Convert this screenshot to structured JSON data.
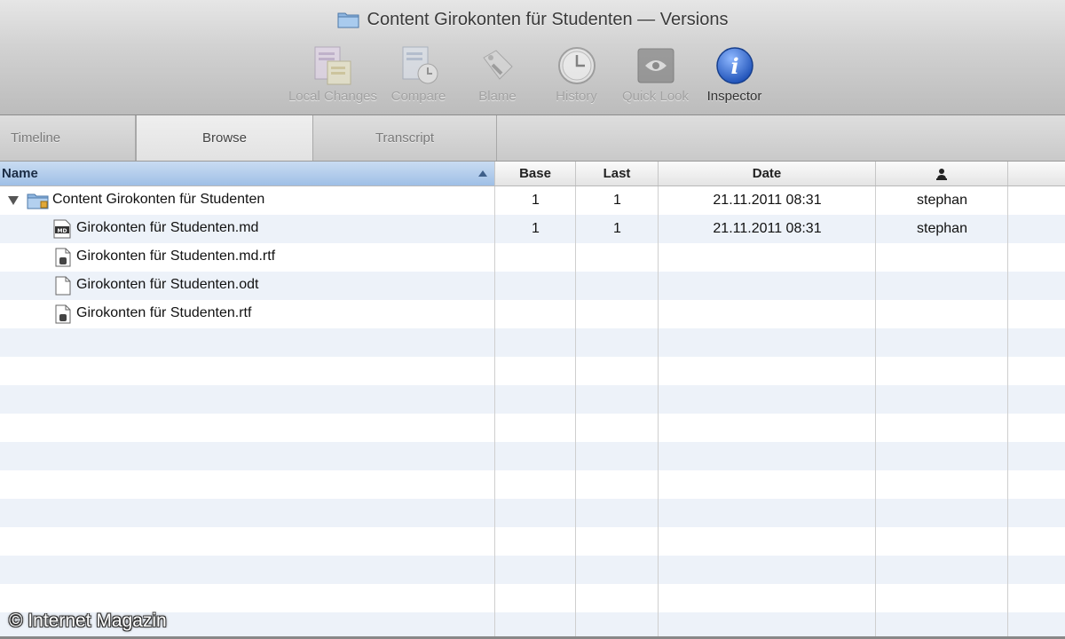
{
  "window": {
    "title": "Content Girokonten für Studenten — Versions"
  },
  "toolbar": {
    "items": [
      {
        "label": "Local Changes",
        "icon": "local-changes-icon",
        "enabled": false
      },
      {
        "label": "Compare",
        "icon": "compare-icon",
        "enabled": false
      },
      {
        "label": "Blame",
        "icon": "blame-icon",
        "enabled": false
      },
      {
        "label": "History",
        "icon": "history-clock-icon",
        "enabled": false
      },
      {
        "label": "Quick Look",
        "icon": "quick-look-eye-icon",
        "enabled": false
      },
      {
        "label": "Inspector",
        "icon": "info-icon",
        "enabled": true
      }
    ]
  },
  "tabs": [
    {
      "label": "Timeline",
      "selected": false
    },
    {
      "label": "Browse",
      "selected": true
    },
    {
      "label": "Transcript",
      "selected": false
    }
  ],
  "table": {
    "columns": {
      "name": "Name",
      "base": "Base",
      "last": "Last",
      "date": "Date",
      "user_icon": "person-icon"
    },
    "rows": [
      {
        "name": "Content Girokonten für Studenten",
        "type": "folder",
        "icon": "folder-icon",
        "expanded": true,
        "base": "1",
        "last": "1",
        "date": "21.11.2011 08:31",
        "user": "stephan"
      },
      {
        "name": "Girokonten für Studenten.md",
        "type": "file",
        "icon": "markdown-file-icon",
        "base": "1",
        "last": "1",
        "date": "21.11.2011 08:31",
        "user": "stephan"
      },
      {
        "name": "Girokonten für Studenten.md.rtf",
        "type": "file",
        "icon": "rtf-file-icon",
        "base": "",
        "last": "",
        "date": "",
        "user": ""
      },
      {
        "name": "Girokonten für Studenten.odt",
        "type": "file",
        "icon": "document-file-icon",
        "base": "",
        "last": "",
        "date": "",
        "user": ""
      },
      {
        "name": "Girokonten für Studenten.rtf",
        "type": "file",
        "icon": "rtf-file-icon",
        "base": "",
        "last": "",
        "date": "",
        "user": ""
      }
    ]
  },
  "watermark": "© Internet Magazin",
  "colors": {
    "selected_column_header": "#a9c6ea",
    "row_stripe": "#edf2f9",
    "inspector_blue": "#2f6fd6"
  }
}
